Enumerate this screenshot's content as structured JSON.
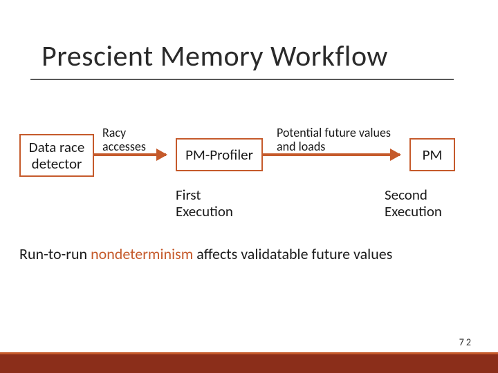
{
  "title": "Prescient Memory Workflow",
  "boxes": {
    "detector": "Data race detector",
    "profiler": "PM-Profiler",
    "pm": "PM"
  },
  "edges": {
    "racy": "Racy accesses",
    "future": "Potential future values and loads"
  },
  "exec": {
    "first": "First Execution",
    "second": "Second Execution"
  },
  "caption": {
    "pre": "Run-to-run ",
    "hl": "nondeterminism",
    "post": " affects validatable future values"
  },
  "page": "72"
}
